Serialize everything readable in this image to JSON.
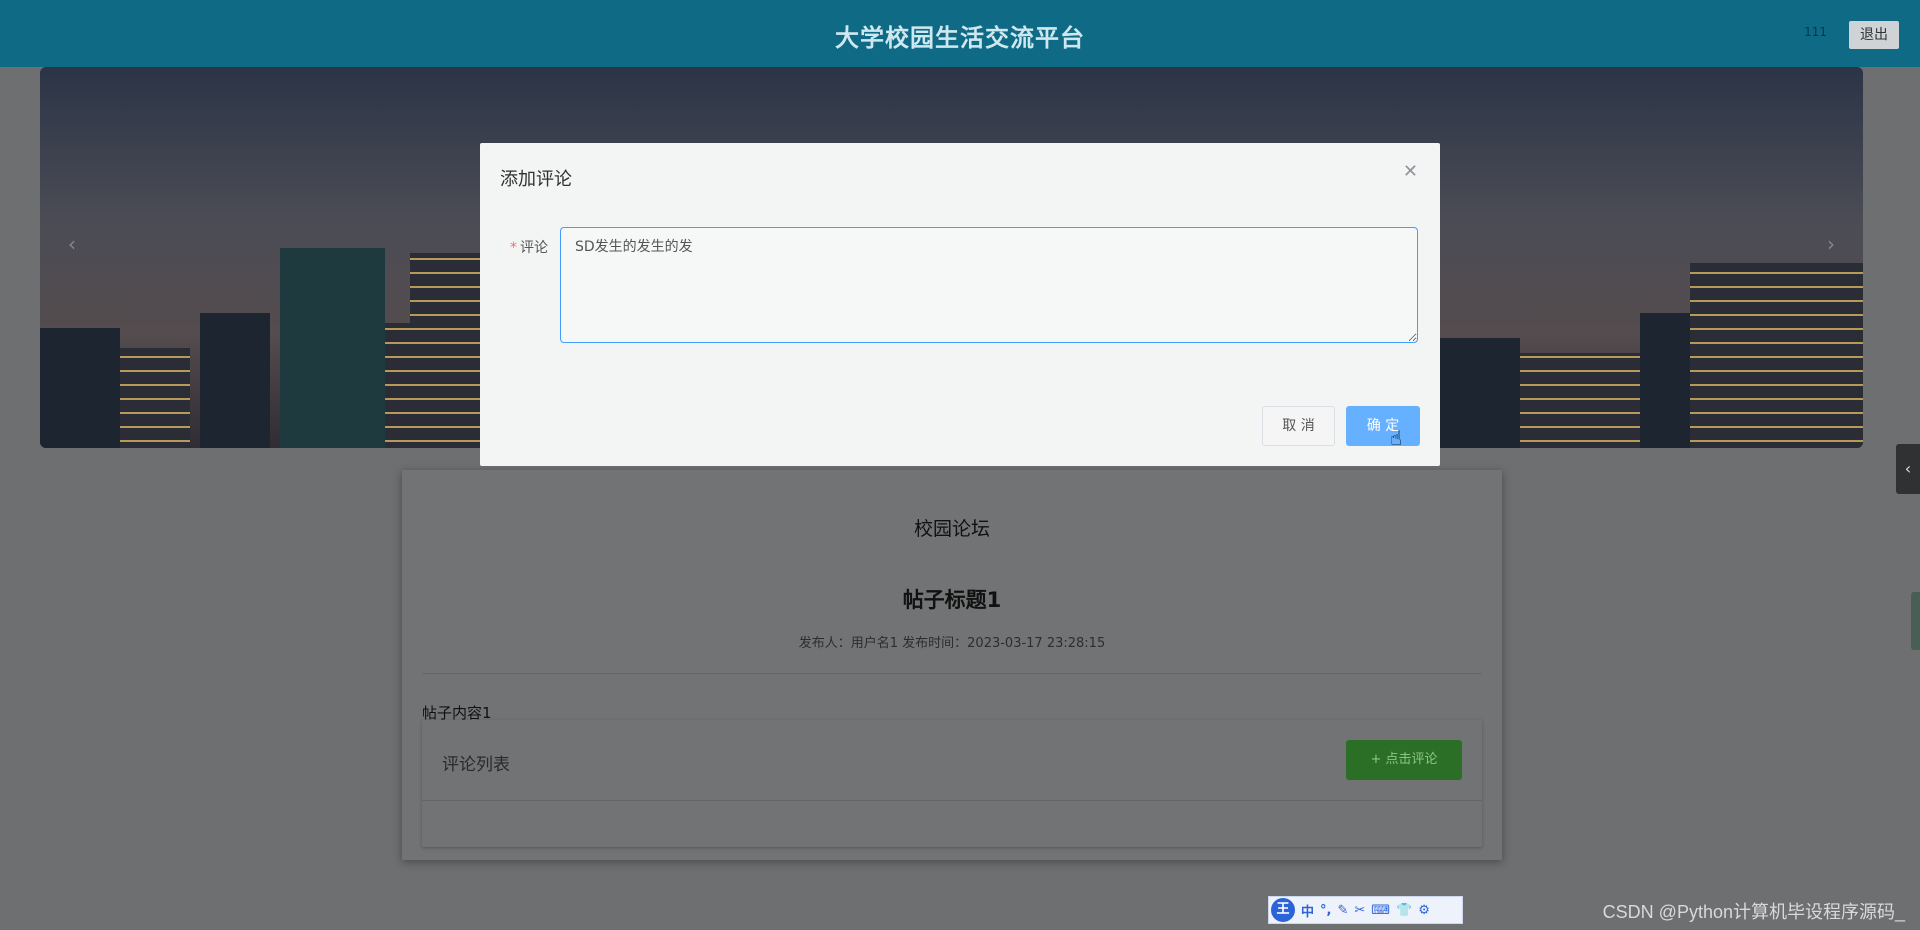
{
  "header": {
    "title": "大学校园生活交流平台",
    "username": "111",
    "logout_label": "退出"
  },
  "banner": {
    "prev_icon": "chevron-left-icon",
    "next_icon": "chevron-right-icon"
  },
  "forum": {
    "section_title": "校园论坛",
    "post_title": "帖子标题1",
    "meta": "发布人：用户名1  发布时间：2023-03-17 23:28:15",
    "content": "帖子内容1",
    "comments_label": "评论列表",
    "comment_button": "+ 点击评论"
  },
  "dialog": {
    "title": "添加评论",
    "field_label": "评论",
    "field_value": "SD发生的发生的发",
    "cancel_label": "取 消",
    "confirm_label": "确 定"
  },
  "ime": {
    "logo": "王",
    "items": [
      "中",
      "°,",
      "✎",
      "✂",
      "⌨",
      "👕",
      "⚙"
    ]
  },
  "watermark": "CSDN @Python计算机毕设程序源码_",
  "colors": {
    "header": "#0f6a86",
    "primary": "#66b1ff",
    "success": "#2b6f26",
    "required": "#f56c6c"
  }
}
